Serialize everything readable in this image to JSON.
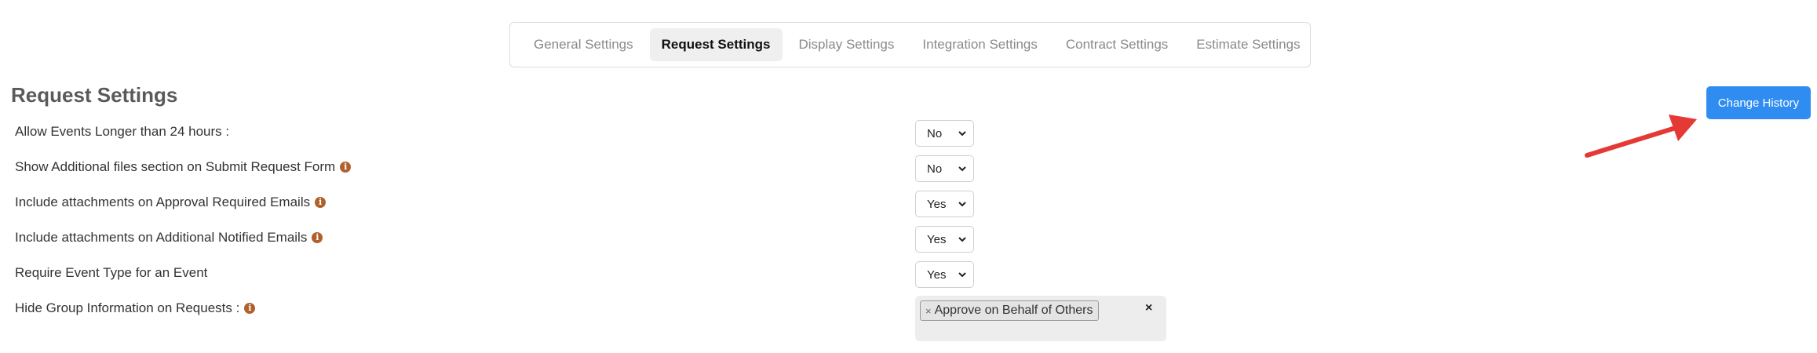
{
  "tabs": [
    {
      "label": "General Settings",
      "active": false
    },
    {
      "label": "Request Settings",
      "active": true
    },
    {
      "label": "Display Settings",
      "active": false
    },
    {
      "label": "Integration Settings",
      "active": false
    },
    {
      "label": "Contract Settings",
      "active": false
    },
    {
      "label": "Estimate Settings",
      "active": false
    }
  ],
  "page": {
    "title": "Request Settings",
    "change_history_label": "Change History"
  },
  "settings": [
    {
      "label": "Allow Events Longer than 24 hours :",
      "info_icon": false,
      "value": "No"
    },
    {
      "label": "Show Additional files section on Submit Request Form",
      "info_icon": true,
      "value": "No"
    },
    {
      "label": "Include attachments on Approval Required Emails",
      "info_icon": true,
      "value": "Yes"
    },
    {
      "label": "Include attachments on Additional Notified Emails",
      "info_icon": true,
      "value": "Yes"
    },
    {
      "label": "Require Event Type for an Event",
      "info_icon": false,
      "value": "Yes"
    },
    {
      "label": "Hide Group Information on Requests :",
      "info_icon": true,
      "selected_tags": [
        "Approve on Behalf of Others"
      ]
    }
  ],
  "icons": {
    "info": "info-icon",
    "chevron": "chevron-down-icon",
    "remove": "close-icon",
    "annotation": "red-arrow"
  },
  "colors": {
    "accent": "#2f8df2",
    "info_icon": "#b0612b",
    "annotation_arrow": "#e53935"
  }
}
